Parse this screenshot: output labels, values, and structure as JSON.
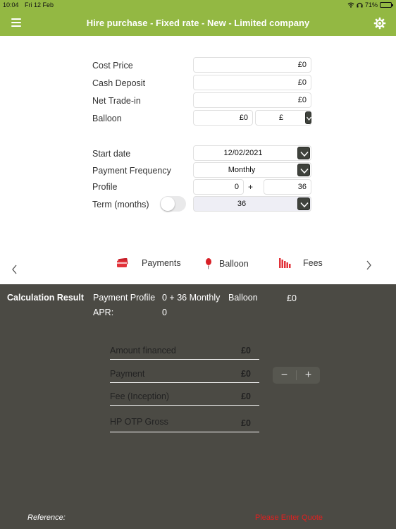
{
  "status_bar": {
    "time": "10:04",
    "date": "Fri 12 Feb",
    "battery": "71%"
  },
  "nav": {
    "title": "Hire purchase - Fixed rate - New - Limited company"
  },
  "form": {
    "cost_price": {
      "label": "Cost Price",
      "value": "£0"
    },
    "cash_deposit": {
      "label": "Cash Deposit",
      "value": "£0"
    },
    "net_trade_in": {
      "label": "Net Trade-in",
      "value": "£0"
    },
    "balloon": {
      "label": "Balloon",
      "value": "£0",
      "unit": "£"
    },
    "start_date": {
      "label": "Start date",
      "value": "12/02/2021"
    },
    "payment_frequency": {
      "label": "Payment Frequency",
      "value": "Monthly"
    },
    "profile": {
      "label": "Profile",
      "upfront": "0",
      "plus": "+",
      "payments": "36"
    },
    "term": {
      "label": "Term (months)",
      "value": "36",
      "toggle_on": false
    }
  },
  "tabs": [
    {
      "label": "Payments",
      "icon": "card-icon"
    },
    {
      "label": "Balloon",
      "icon": "balloon-icon"
    },
    {
      "label": "Fees",
      "icon": "fees-bars-icon"
    }
  ],
  "result": {
    "heading": "Calculation Result",
    "payment_profile_label": "Payment Profile",
    "payment_profile_value": "0 + 36 Monthly",
    "balloon_label": "Balloon",
    "balloon_value": "£0",
    "apr_label": "APR:",
    "apr_value": "0",
    "rows": [
      {
        "label": "Amount financed",
        "value": "£0"
      },
      {
        "label": "Payment",
        "value": "£0"
      },
      {
        "label": "Fee (Inception)",
        "value": "£0"
      },
      {
        "label": "HP OTP Gross",
        "value": "£0"
      }
    ],
    "stepper": {
      "minus": "−",
      "plus": "+"
    },
    "reference_label": "Reference:",
    "reference_value": "Please Enter Quote"
  },
  "colors": {
    "accent": "#93b843",
    "result_bg": "#4b4a44",
    "dropdown_btn": "#3f423c",
    "warning": "#e02020"
  }
}
